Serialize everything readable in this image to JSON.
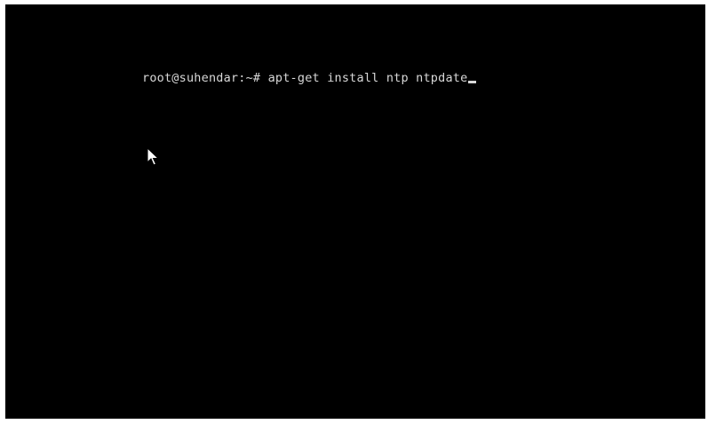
{
  "terminal": {
    "prompt": "root@suhendar:~#",
    "command": "apt-get install ntp ntpdate",
    "background_color": "#000000",
    "text_color": "#d8d8d8"
  },
  "pointer": {
    "icon": "arrow-pointer-icon"
  }
}
